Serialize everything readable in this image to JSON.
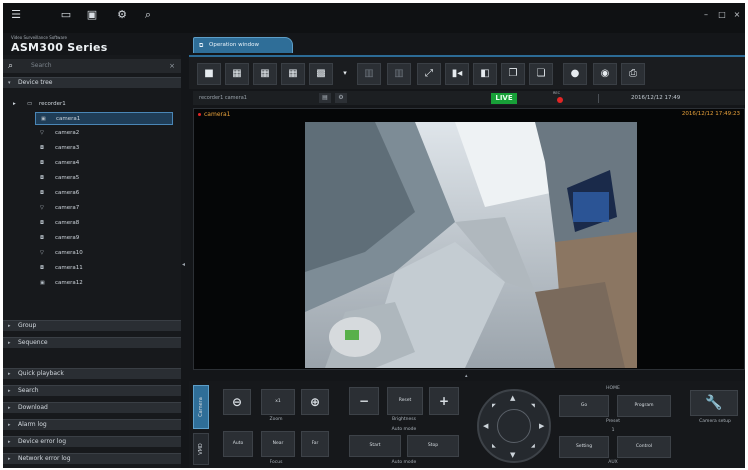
{
  "topbar": {
    "icons": [
      "menu-icon",
      "monitor-icon",
      "display-icon",
      "settings-icon",
      "search-icon"
    ],
    "window_controls": [
      "–",
      "□",
      "×"
    ]
  },
  "brand": {
    "subtitle": "Video Surveillance Software",
    "title": "ASM300 Series"
  },
  "sidebar": {
    "search_placeholder": "Search",
    "search_clear": "×",
    "sections_top": [
      {
        "label": "Device tree"
      }
    ],
    "tree_root": {
      "arrow": "▸",
      "icon": "▭",
      "label": "recorder1"
    },
    "cameras": [
      {
        "label": "camera1",
        "selected": true
      },
      {
        "label": "camera2"
      },
      {
        "label": "camera3"
      },
      {
        "label": "camera4"
      },
      {
        "label": "camera5"
      },
      {
        "label": "camera6"
      },
      {
        "label": "camera7"
      },
      {
        "label": "camera8"
      },
      {
        "label": "camera9"
      },
      {
        "label": "camera10"
      },
      {
        "label": "camera11"
      },
      {
        "label": "camera12"
      }
    ],
    "sections_mid": [
      {
        "label": "Group"
      },
      {
        "label": "Sequence"
      }
    ],
    "sections_bottom": [
      {
        "label": "Quick playback"
      },
      {
        "label": "Search"
      },
      {
        "label": "Download"
      },
      {
        "label": "Alarm log"
      },
      {
        "label": "Device error log"
      },
      {
        "label": "Network error log"
      }
    ]
  },
  "tab": {
    "label": "Operation window"
  },
  "toolbar": {
    "buttons": [
      "1-screen-layout",
      "4-screen-layout",
      "6-screen-layout",
      "9-screen-layout",
      "16-screen-layout",
      "dropdown",
      "prev-page",
      "next-page",
      "fullscreen",
      "playback",
      "snapshot-compare",
      "copy",
      "paste",
      "record",
      "camera",
      "print"
    ]
  },
  "infobar": {
    "breadcrumb": "recorder1 camera1",
    "live": "LIVE",
    "rec": "REC",
    "datetime": "2016/12/12 17:49"
  },
  "viewer": {
    "camera_label": "camera1",
    "timestamp": "2016/12/12 17:49:23"
  },
  "control": {
    "tabs": [
      "Camera",
      "VMD"
    ],
    "zoom_label": "Zoom",
    "zoom_x1": "x1",
    "brightness_label": "Brightness",
    "brightness_reset": "Reset",
    "focus_label": "Focus",
    "focus_auto": "Auto",
    "focus_near": "Near",
    "focus_far": "Far",
    "automode_label": "Auto mode",
    "automode_title": "Auto mode",
    "automode_start": "Start",
    "automode_stop": "Stop",
    "preset_home": "HOME",
    "preset_go": "Go",
    "preset_program": "Program",
    "preset_label": "Preset",
    "aux_value": "1",
    "aux_setting": "Setting",
    "aux_control": "Control",
    "aux_label": "AUX",
    "camera_setup": "Camera setup"
  }
}
